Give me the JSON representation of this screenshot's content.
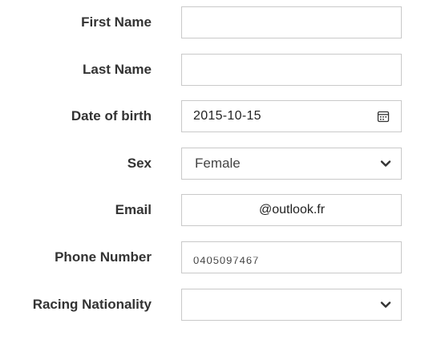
{
  "form": {
    "first_name": {
      "label": "First Name",
      "value": ""
    },
    "last_name": {
      "label": "Last Name",
      "value": ""
    },
    "date_of_birth": {
      "label": "Date of birth",
      "value": "2015-10-15",
      "icon": "calendar-icon"
    },
    "sex": {
      "label": "Sex",
      "value": "Female",
      "icon": "chevron-down-icon"
    },
    "email": {
      "label": "Email",
      "value": "@outlook.fr"
    },
    "phone_number": {
      "label": "Phone Number",
      "value": "0405097467"
    },
    "racing_nationality": {
      "label": "Racing Nationality",
      "value": "",
      "icon": "chevron-down-icon"
    }
  },
  "colors": {
    "label_text": "#333333",
    "field_border": "#c9c9c9",
    "background": "#ffffff"
  }
}
